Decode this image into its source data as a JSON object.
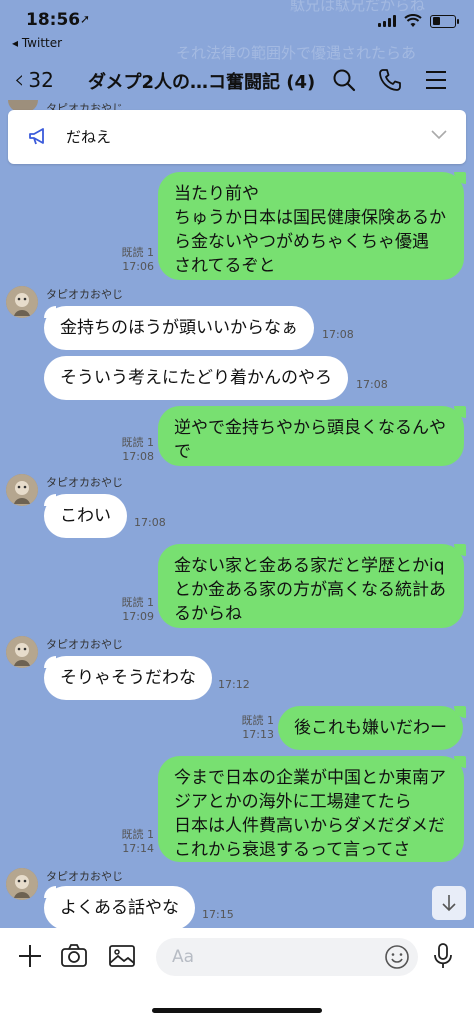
{
  "status": {
    "time": "18:56",
    "back_app": "◂ Twitter",
    "battery_level": 0.35
  },
  "header": {
    "back_count": "32",
    "title": "ダメプ2人の…コ奮闘記 (4)"
  },
  "ghost": {
    "line1": "駄兄は駄兄だからね",
    "line2": "それ法律の範囲外で優遇されたらあ"
  },
  "notice": {
    "text": "だねえ"
  },
  "sender_name": "タピオカおやじ",
  "messages": {
    "m1": {
      "lines": [
        "当たり前や",
        "ちゅうか日本は国民健康保険あるか",
        "ら金ないやつがめちゃくちゃ優遇",
        "されてるぞと"
      ],
      "read": "既読 1",
      "time": "17:06"
    },
    "m2": {
      "text": "金持ちのほうが頭いいからなぁ",
      "time": "17:08"
    },
    "m3": {
      "text": "そういう考えにたどり着かんのやろ",
      "time": "17:08"
    },
    "m4": {
      "lines": [
        "逆やで金持ちやから頭良くなるんや",
        "で"
      ],
      "read": "既読 1",
      "time": "17:08"
    },
    "m5": {
      "text": "こわい",
      "time": "17:08"
    },
    "m6": {
      "lines": [
        "金ない家と金ある家だと学歴とかiq",
        "とか金ある家の方が高くなる統計あ",
        "るからね"
      ],
      "read": "既読 1",
      "time": "17:09"
    },
    "m7": {
      "text": "そりゃそうだわな",
      "time": "17:12"
    },
    "m8": {
      "text": "後これも嫌いだわー",
      "read": "既読 1",
      "time": "17:13"
    },
    "m9": {
      "lines": [
        "今まで日本の企業が中国とか東南ア",
        "ジアとかの海外に工場建てたら",
        "日本は人件費高いからダメだダメだ",
        "これから衰退するって言ってさ"
      ],
      "read": "既読 1",
      "time": "17:14"
    },
    "m10": {
      "text": "よくある話やな",
      "time": "17:15"
    }
  },
  "input": {
    "placeholder": "Aa"
  },
  "colors": {
    "background": "#8aa6d9",
    "own_bubble": "#78e071",
    "other_bubble": "#ffffff"
  }
}
